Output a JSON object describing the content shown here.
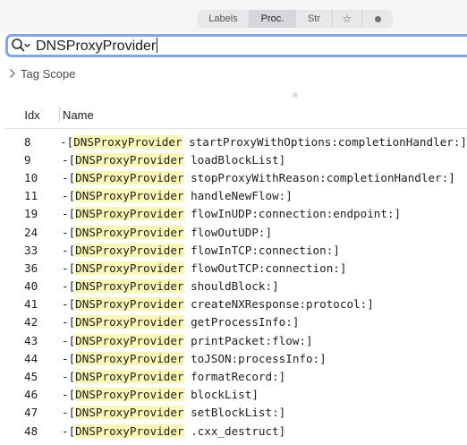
{
  "toolbar": {
    "segments": [
      {
        "label": "Labels",
        "active": false
      },
      {
        "label": "Proc.",
        "active": true
      },
      {
        "label": "Str",
        "active": false
      },
      {
        "label": "☆",
        "active": false
      },
      {
        "icon": "record-dot-icon",
        "active": false
      }
    ]
  },
  "search": {
    "icon": "search-icon",
    "value": "DNSProxyProvider",
    "focus_color": "#7fa7e6"
  },
  "scope": {
    "label": "Tag Scope",
    "icon": "chevron-right-icon"
  },
  "table": {
    "columns": {
      "idx": "Idx",
      "name": "Name"
    },
    "highlight_color": "#fbf7b4",
    "rows": [
      {
        "idx": "8",
        "prefix": "-[",
        "cls": "DNSProxyProvider",
        "method": " startProxyWithOptions:completionHandler:]"
      },
      {
        "idx": "9",
        "prefix": "-[",
        "cls": "DNSProxyProvider",
        "method": " loadBlockList]"
      },
      {
        "idx": "10",
        "prefix": "-[",
        "cls": "DNSProxyProvider",
        "method": " stopProxyWithReason:completionHandler:]"
      },
      {
        "idx": "11",
        "prefix": "-[",
        "cls": "DNSProxyProvider",
        "method": " handleNewFlow:]"
      },
      {
        "idx": "19",
        "prefix": "-[",
        "cls": "DNSProxyProvider",
        "method": " flowInUDP:connection:endpoint:]"
      },
      {
        "idx": "24",
        "prefix": "-[",
        "cls": "DNSProxyProvider",
        "method": " flowOutUDP:]"
      },
      {
        "idx": "33",
        "prefix": "-[",
        "cls": "DNSProxyProvider",
        "method": " flowInTCP:connection:]"
      },
      {
        "idx": "36",
        "prefix": "-[",
        "cls": "DNSProxyProvider",
        "method": " flowOutTCP:connection:]"
      },
      {
        "idx": "40",
        "prefix": "-[",
        "cls": "DNSProxyProvider",
        "method": " shouldBlock:]"
      },
      {
        "idx": "41",
        "prefix": "-[",
        "cls": "DNSProxyProvider",
        "method": " createNXResponse:protocol:]"
      },
      {
        "idx": "42",
        "prefix": "-[",
        "cls": "DNSProxyProvider",
        "method": " getProcessInfo:]"
      },
      {
        "idx": "43",
        "prefix": "-[",
        "cls": "DNSProxyProvider",
        "method": " printPacket:flow:]"
      },
      {
        "idx": "44",
        "prefix": "-[",
        "cls": "DNSProxyProvider",
        "method": " toJSON:processInfo:]"
      },
      {
        "idx": "45",
        "prefix": "-[",
        "cls": "DNSProxyProvider",
        "method": " formatRecord:]"
      },
      {
        "idx": "46",
        "prefix": "-[",
        "cls": "DNSProxyProvider",
        "method": " blockList]"
      },
      {
        "idx": "47",
        "prefix": "-[",
        "cls": "DNSProxyProvider",
        "method": " setBlockList:]"
      },
      {
        "idx": "48",
        "prefix": "-[",
        "cls": "DNSProxyProvider",
        "method": " .cxx_destruct]"
      }
    ]
  }
}
